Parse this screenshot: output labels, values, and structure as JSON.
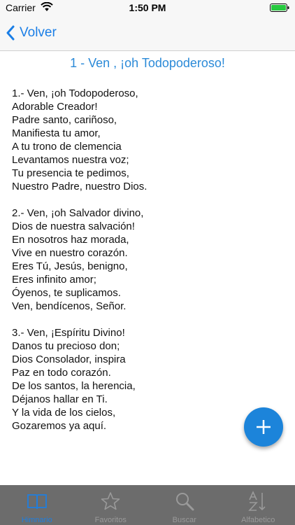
{
  "status_bar": {
    "carrier": "Carrier",
    "time": "1:50 PM"
  },
  "nav": {
    "back_label": "Volver"
  },
  "hymn": {
    "title": "1 - Ven , ¡oh Todopoderoso!",
    "stanzas": [
      [
        "1.- Ven, ¡oh Todopoderoso,",
        "Adorable Creador!",
        "Padre santo, cariñoso,",
        "Manifiesta tu amor,",
        "A tu trono de clemencia",
        "Levantamos nuestra voz;",
        "Tu presencia te pedimos,",
        "Nuestro Padre, nuestro Dios."
      ],
      [
        "2.- Ven, ¡oh Salvador divino,",
        "Dios de nuestra salvación!",
        "En nosotros haz morada,",
        "Vive en nuestro corazón.",
        "Eres Tú, Jesús, benigno,",
        "Eres infinito amor;",
        "Óyenos, te suplicamos.",
        "Ven, bendícenos, Señor."
      ],
      [
        "3.- Ven, ¡Espíritu Divino!",
        "Danos tu precioso don;",
        "Dios Consolador, inspira",
        "Paz en todo corazón.",
        "De los santos, la herencia,",
        "Déjanos hallar en Ti.",
        "Y la vida de los cielos,",
        "Gozaremos ya aquí."
      ]
    ]
  },
  "fab": {
    "icon": "plus-icon"
  },
  "tabs": [
    {
      "label": "Himnario",
      "icon": "book-icon",
      "active": true
    },
    {
      "label": "Favoritos",
      "icon": "star-icon",
      "active": false
    },
    {
      "label": "Buscar",
      "icon": "search-icon",
      "active": false
    },
    {
      "label": "Alfabetico",
      "icon": "sort-az-icon",
      "active": false
    }
  ],
  "colors": {
    "accent": "#1a7ee6",
    "title": "#2b8ad8",
    "fab": "#1c84da",
    "tab_bar": "#6c6c6c"
  }
}
